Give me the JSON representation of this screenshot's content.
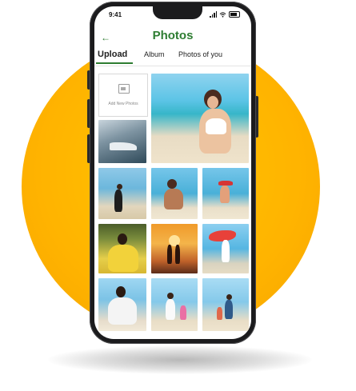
{
  "status": {
    "time": "9:41"
  },
  "appbar": {
    "title": "Photos",
    "back_icon": "←"
  },
  "tabs": [
    {
      "label": "Upload",
      "active": true
    },
    {
      "label": "Album",
      "active": false
    },
    {
      "label": "Photos of you",
      "active": false
    }
  ],
  "grid": {
    "add_new_label": "Add New Photos",
    "photos": [
      "beach-portrait",
      "boat",
      "beach-walk",
      "beach-sitting",
      "surf-splash",
      "yellow-dress",
      "sunset-couple",
      "scarf-beach",
      "white-dress",
      "family-beach",
      "family-walk"
    ]
  },
  "colors": {
    "accent": "#2e7d32",
    "sun": "#ffb300"
  }
}
